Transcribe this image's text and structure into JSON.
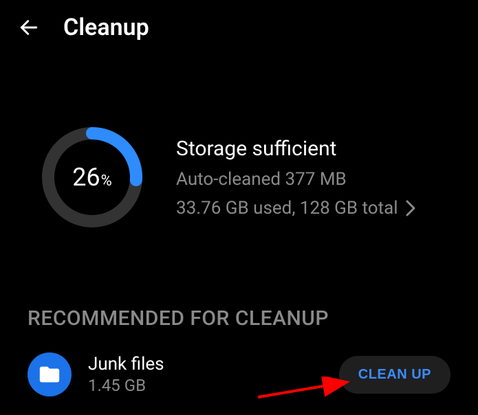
{
  "header": {
    "title": "Cleanup"
  },
  "storage": {
    "percent_value": "26",
    "percent_unit": "%",
    "percent_numeric": 26,
    "status": "Storage sufficient",
    "auto_cleaned": "Auto-cleaned 377 MB",
    "usage": "33.76 GB used, 128 GB total"
  },
  "recommended": {
    "heading": "RECOMMENDED FOR CLEANUP",
    "items": [
      {
        "title": "Junk files",
        "size": "1.45 GB",
        "action_label": "CLEAN UP"
      }
    ]
  },
  "colors": {
    "accent": "#1c72e8",
    "ring_bg": "#333333",
    "ring_fg": "#2e8cff"
  }
}
